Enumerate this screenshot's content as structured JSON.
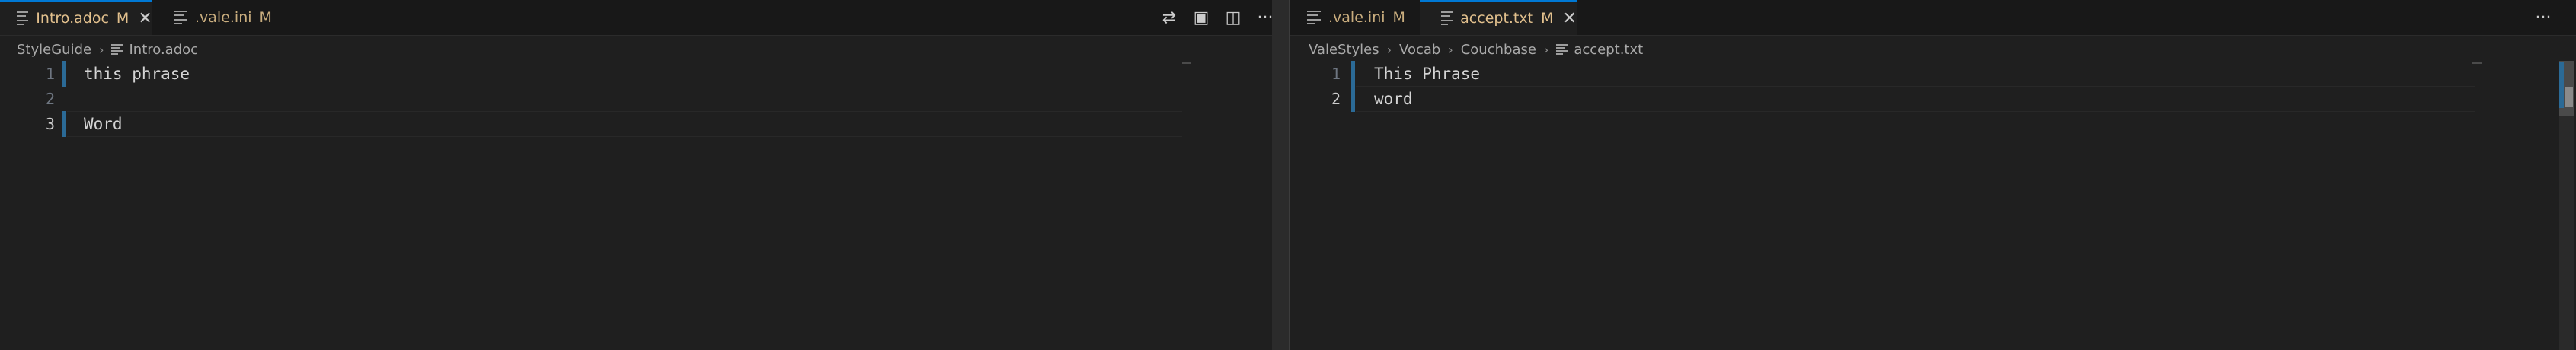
{
  "left_editor": {
    "tabs": [
      {
        "label": "Intro.adoc",
        "status": "M",
        "close": "✕"
      },
      {
        "label": ".vale.ini",
        "status": "M"
      }
    ],
    "actions": {
      "compare": "⇄",
      "preview": "▣",
      "split": "◫",
      "more": "···"
    },
    "breadcrumb": [
      "StyleGuide",
      "Intro.adoc"
    ],
    "lines": [
      {
        "number": "1",
        "text": "this phrase"
      },
      {
        "number": "2",
        "text": ""
      },
      {
        "number": "3",
        "text": "Word"
      }
    ]
  },
  "right_editor": {
    "tabs": [
      {
        "label": ".vale.ini",
        "status": "M"
      },
      {
        "label": "accept.txt",
        "status": "M",
        "close": "✕"
      }
    ],
    "actions": {
      "more": "···"
    },
    "breadcrumb": [
      "ValeStyles",
      "Vocab",
      "Couchbase",
      "accept.txt"
    ],
    "lines": [
      {
        "number": "1",
        "text": "This Phrase"
      },
      {
        "number": "2",
        "text": "word"
      }
    ]
  },
  "icons": {
    "file": "file-lines-icon",
    "chevron": "›"
  },
  "colors": {
    "background": "#1f1f1f",
    "tabbar": "#181818",
    "modified_label": "#e2c08d",
    "accent": "#0078d4"
  }
}
